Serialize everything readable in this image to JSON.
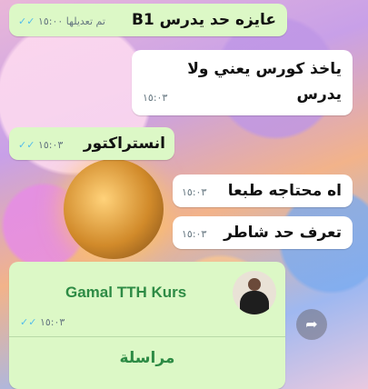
{
  "messages": [
    {
      "id": "m1",
      "text": "عايزه حد يدرس B1",
      "edited": "تم تعديلها",
      "time": "١٥:٠٠"
    },
    {
      "id": "m2",
      "text_line1": "ياخذ كورس يعني ولا",
      "text_line2": "يدرس",
      "time": "١٥:٠٣"
    },
    {
      "id": "m3",
      "text": "انستراكتور",
      "time": "١٥:٠٣"
    },
    {
      "id": "m4",
      "text": "اه محتاجه طبعا",
      "time": "١٥:٠٣"
    },
    {
      "id": "m5",
      "text": "تعرف حد شاطر",
      "time": "١٥:٠٣"
    }
  ],
  "contact_card": {
    "name": "Gamal TTH Kurs",
    "time": "١٥:٠٣",
    "action_label": "مراسلة"
  },
  "icons": {
    "read_receipt": "double-check-icon",
    "forward": "forward-icon"
  },
  "colors": {
    "outgoing_bubble": "#dcf8c6",
    "incoming_bubble": "#ffffff",
    "contact_name": "#2e8b45",
    "read_ticks": "#53bdeb"
  }
}
